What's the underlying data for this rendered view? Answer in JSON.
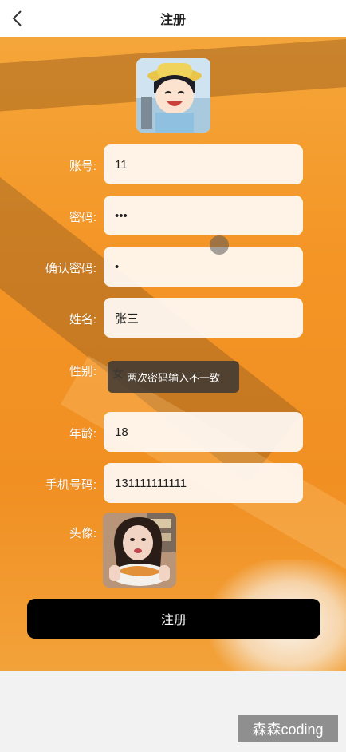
{
  "header": {
    "title": "注册",
    "back_icon": "chevron-left-icon"
  },
  "form": {
    "account": {
      "label": "账号:",
      "value": "11"
    },
    "password": {
      "label": "密码:",
      "value": "•••"
    },
    "confirm_password": {
      "label": "确认密码:",
      "value": "•"
    },
    "name": {
      "label": "姓名:",
      "value": "张三"
    },
    "gender": {
      "label": "性别:",
      "value": "女"
    },
    "age": {
      "label": "年龄:",
      "value": "18"
    },
    "phone": {
      "label": "手机号码:",
      "value": "131111111111"
    },
    "avatar": {
      "label": "头像:"
    }
  },
  "toast": {
    "message": "两次密码输入不一致"
  },
  "submit": {
    "label": "注册"
  },
  "watermark": {
    "text": "森森coding"
  },
  "colors": {
    "accent": "#f49526",
    "button": "#000000",
    "field_bg": "#fffaf5"
  }
}
